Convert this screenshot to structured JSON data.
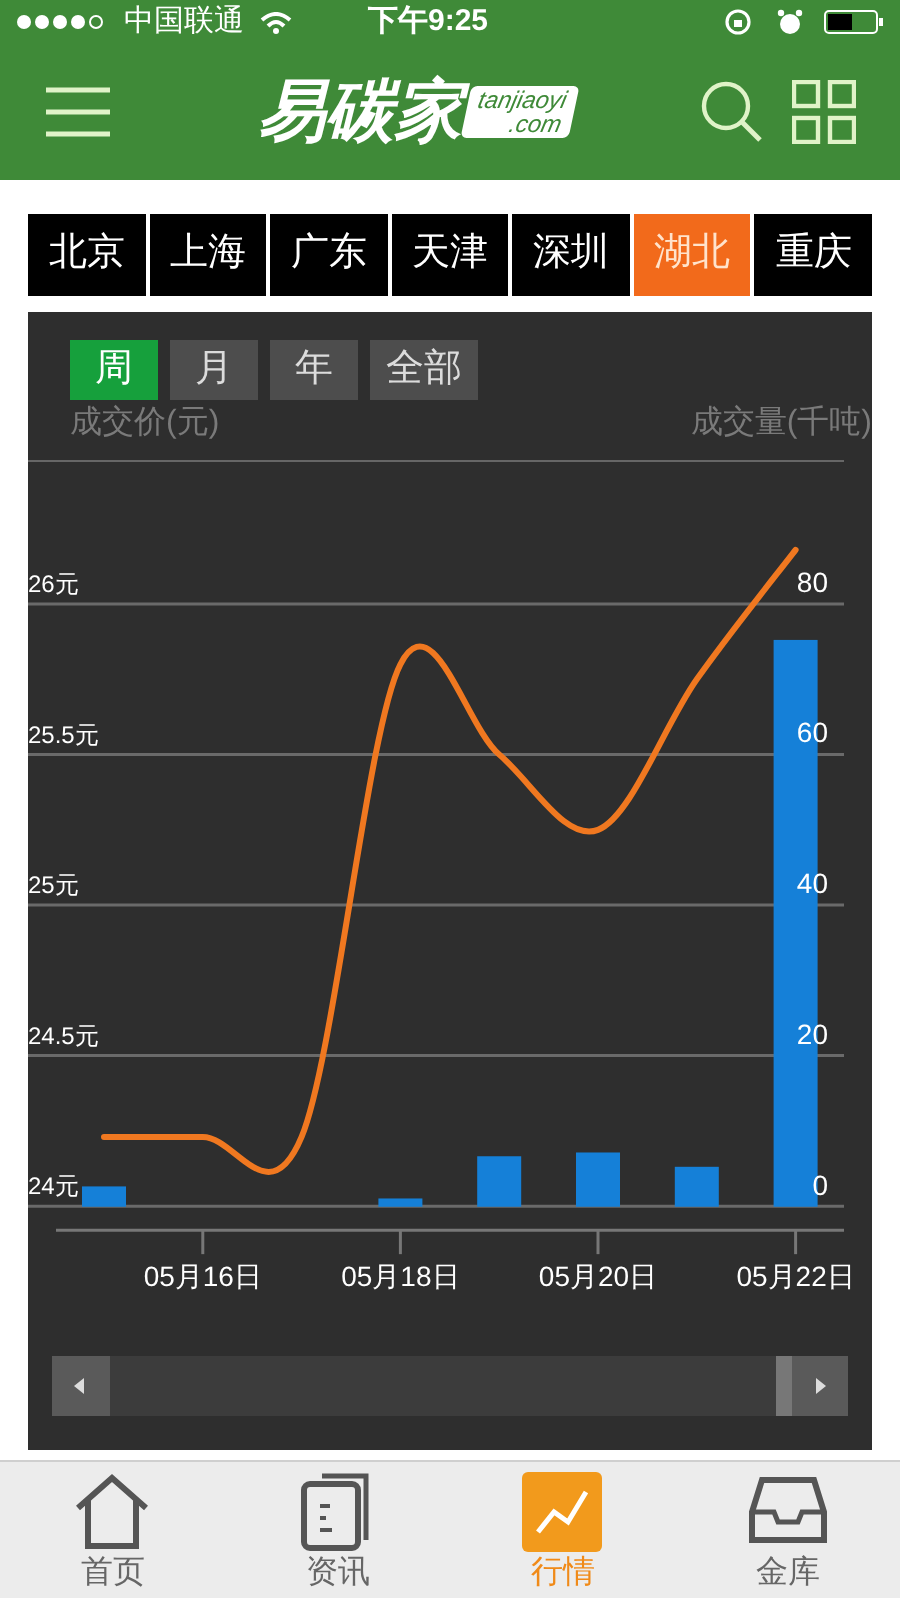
{
  "status_bar": {
    "carrier": "中国联通",
    "time": "下午9:25"
  },
  "header": {
    "logo": {
      "name": "易碳家",
      "badge_line_1": "tanjiaoyi",
      "badge_line_2": ".com"
    }
  },
  "city_tabs": [
    {
      "label": "北京",
      "selected": false
    },
    {
      "label": "上海",
      "selected": false
    },
    {
      "label": "广东",
      "selected": false
    },
    {
      "label": "天津",
      "selected": false
    },
    {
      "label": "深圳",
      "selected": false
    },
    {
      "label": "湖北",
      "selected": true
    },
    {
      "label": "重庆",
      "selected": false
    }
  ],
  "period_tabs": [
    {
      "label": "周",
      "selected": true
    },
    {
      "label": "月",
      "selected": false
    },
    {
      "label": "年",
      "selected": false
    },
    {
      "label": "全部",
      "selected": false
    }
  ],
  "chart": {
    "chart_data": {
      "type": "line",
      "ylabel": "成交价(元)",
      "y2label": "成交量(千吨)",
      "categories": [
        null,
        "05月16日",
        null,
        "05月18日",
        null,
        "05月20日",
        null,
        "05月22日"
      ],
      "grid": true,
      "series": [
        {
          "color": "#f07820",
          "values": [
            24.23,
            24.23,
            24.23,
            25.8,
            25.5,
            25.25,
            25.75,
            26.18
          ]
        },
        {
          "type": "bar",
          "axis": "y2",
          "color": "#1580d8",
          "values": [
            2.7,
            null,
            null,
            1.1,
            6.7,
            7.2,
            5.3,
            75.2
          ]
        }
      ],
      "ylim": [
        23.19,
        26.99
      ],
      "y2lim": [
        -32.27,
        119.5
      ],
      "yticks": [
        {
          "value": 24,
          "label": "24元"
        },
        {
          "value": 24.5,
          "label": "24.5元"
        },
        {
          "value": 25,
          "label": "25元"
        },
        {
          "value": 25.5,
          "label": "25.5元"
        },
        {
          "value": 26,
          "label": "26元"
        }
      ],
      "y2ticks": [
        {
          "value": 0,
          "label": "0"
        },
        {
          "value": 20,
          "label": "20"
        },
        {
          "value": 40,
          "label": "40"
        },
        {
          "value": 60,
          "label": "60"
        },
        {
          "value": 80,
          "label": "80"
        }
      ]
    }
  },
  "bottom_nav": [
    {
      "label": "首页",
      "kind": "home",
      "selected": false
    },
    {
      "label": "资讯",
      "kind": "news",
      "selected": false
    },
    {
      "label": "行情",
      "kind": "market",
      "selected": true
    },
    {
      "label": "金库",
      "kind": "vault",
      "selected": false
    }
  ]
}
